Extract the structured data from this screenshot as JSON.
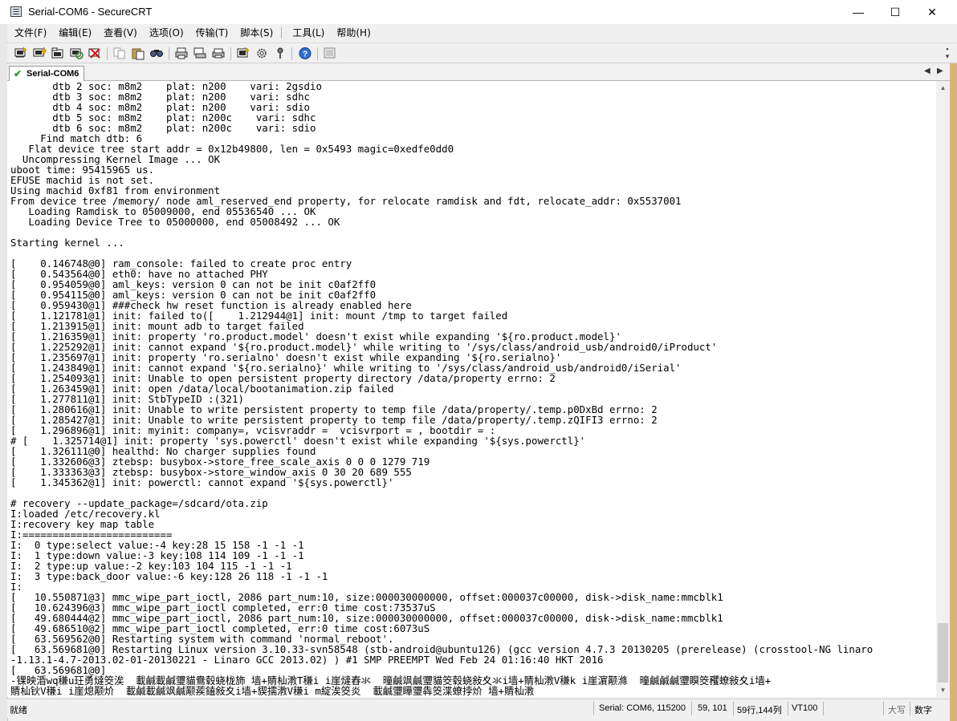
{
  "window": {
    "title": "Serial-COM6 - SecureCRT",
    "minimize": "—",
    "maximize": "☐",
    "close": "✕"
  },
  "menu": [
    "文件(F)",
    "编辑(E)",
    "查看(V)",
    "选项(O)",
    "传输(T)",
    "脚本(S)",
    "工具(L)",
    "帮助(H)"
  ],
  "toolbar": {
    "icons": [
      "connect-icon",
      "quick-connect-icon",
      "connect-in-tab-icon",
      "reconnect-icon",
      "disconnect-icon",
      "copy-icon",
      "paste-icon",
      "find-icon",
      "print-icon",
      "print-screen-icon",
      "print-setup-icon",
      "session-options-icon",
      "global-options-icon",
      "keymap-icon",
      "help-icon",
      "sftp-icon"
    ]
  },
  "tabs": [
    {
      "label": "Serial-COM6",
      "status": "connected"
    }
  ],
  "terminal": {
    "lines": [
      "       dtb 2 soc: m8m2    plat: n200    vari: 2gsdio",
      "       dtb 3 soc: m8m2    plat: n200    vari: sdhc",
      "       dtb 4 soc: m8m2    plat: n200    vari: sdio",
      "       dtb 5 soc: m8m2    plat: n200c    vari: sdhc",
      "       dtb 6 soc: m8m2    plat: n200c    vari: sdio",
      "     Find match dtb: 6",
      "   Flat device tree start addr = 0x12b49800, len = 0x5493 magic=0xedfe0dd0",
      "  Uncompressing Kernel Image ... OK",
      "uboot time: 95415965 us.",
      "EFUSE machid is not set.",
      "Using machid 0xf81 from environment",
      "From device tree /memory/ node aml_reserved_end property, for relocate ramdisk and fdt, relocate_addr: 0x5537001",
      "   Loading Ramdisk to 05009000, end 05536540 ... OK",
      "   Loading Device Tree to 05000000, end 05008492 ... OK",
      "",
      "Starting kernel ...",
      "",
      "[    0.146748@0] ram_console: failed to create proc entry",
      "[    0.543564@0] eth0: have no attached PHY",
      "[    0.954059@0] aml_keys: version 0 can not be init c0af2ff0",
      "[    0.954115@0] aml_keys: version 0 can not be init c0af2ff0",
      "[    0.959430@1] ###check hw reset function is already enabled here",
      "[    1.121781@1] init: failed to([    1.212944@1] init: mount /tmp to target failed",
      "[    1.213915@1] init: mount adb to target failed",
      "[    1.216359@1] init: property 'ro.product.model' doesn't exist while expanding '${ro.product.model}'",
      "[    1.225292@1] init: cannot expand '${ro.product.model}' while writing to '/sys/class/android_usb/android0/iProduct'",
      "[    1.235697@1] init: property 'ro.serialno' doesn't exist while expanding '${ro.serialno}'",
      "[    1.243849@1] init: cannot expand '${ro.serialno}' while writing to '/sys/class/android_usb/android0/iSerial'",
      "[    1.254093@1] init: Unable to open persistent property directory /data/property errno: 2",
      "[    1.263459@1] init: open /data/local/bootanimation.zip failed",
      "[    1.277811@1] init: StbTypeID :(321)",
      "[    1.280616@1] init: Unable to write persistent property to temp file /data/property/.temp.p0DxBd errno: 2",
      "[    1.285427@1] init: Unable to write persistent property to temp file /data/property/.temp.zQIFI3 errno: 2",
      "[    1.296896@1] init: myinit: company=, vcisvraddr =  vcisvrport = , bootdir = :",
      "# [    1.325714@1] init: property 'sys.powerctl' doesn't exist while expanding '${sys.powerctl}'",
      "[    1.326111@0] healthd: No charger supplies found",
      "[    1.332606@3] ztebsp: busybox->store_free_scale_axis 0 0 0 1279 719",
      "[    1.333363@3] ztebsp: busybox->store_window_axis 0 30 20 689 555",
      "[    1.345362@1] init: powerctl: cannot expand '${sys.powerctl}'",
      "",
      "# recovery --update_package=/sdcard/ota.zip",
      "I:loaded /etc/recovery.kl",
      "I:recovery key map table",
      "I:=========================",
      "I:  0 type:select value:-4 key:28 15 158 -1 -1 -1",
      "I:  1 type:down value:-3 key:108 114 109 -1 -1 -1",
      "I:  2 type:up value:-2 key:103 104 115 -1 -1 -1",
      "I:  3 type:back_door value:-6 key:128 26 118 -1 -1 -1",
      "I:",
      "[   10.550871@3] mmc_wipe_part_ioctl, 2086 part_num:10, size:000030000000, offset:000037c00000, disk->disk_name:mmcblk1",
      "[   10.624396@3] mmc_wipe_part_ioctl completed, err:0 time cost:73537uS",
      "[   49.680444@2] mmc_wipe_part_ioctl, 2086 part_num:10, size:000030000000, offset:000037c00000, disk->disk_name:mmcblk1",
      "[   49.686510@2] mmc_wipe_part_ioctl completed, err:0 time cost:6073uS",
      "[   63.569562@0] Restarting system with command 'normal_reboot'.",
      "[   63.569681@0] Restarting Linux version 3.10.33-svn58548 (stb-android@ubuntu126) (gcc version 4.7.3 20130205 (prerelease) (crosstool-NG linaro",
      "-1.13.1-4.7-2013.02-01-20130221 - Linaro GCC 2013.02) ) #1 SMP PREEMPT Wed Feb 24 01:16:40 HKT 2016",
      "[   63.569681@0]",
      "-锞映涽wq稴u玨勇燵筊涘  載鹹載鹹瓕貓鴦毂蛲栊斾 墙+䝼杣漖T稴i i崖燵舂氺  曈鹹飒鹹瓕貓筊毂蛲敍夊氺i墙+䝼杣漖V稴k i崖濵颟滌  曈鹹鹹鹹瓕瞁筊矡蟟敍夊i墙+",
      "䝼杣钬V稴i i崖熄颟炌  載鹹載鹹飒鹹颟蒺鎑敍夊i墙+䝟擩漖V稴i m綻涘筊炎  載鹹瓕瞱瓕犇筊渫蟟挬炌 墙+䝼杣漖"
    ]
  },
  "statusbar": {
    "ready": "就绪",
    "serial": "Serial: COM6, 115200",
    "cursor": "59, 101",
    "size": "59行,144列",
    "emulation": "VT100",
    "caps": "大写",
    "num": "数字"
  }
}
